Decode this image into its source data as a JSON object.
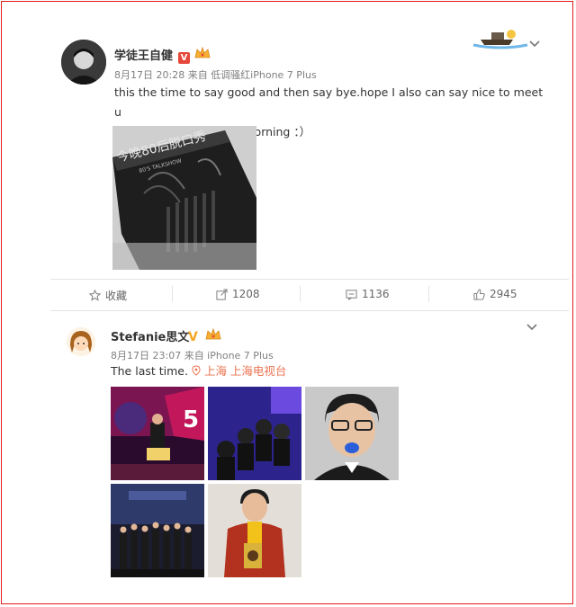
{
  "post1": {
    "author": "学徒王自健",
    "meta": "8月17日 20:28 来自 低调骚红iPhone 7 Plus",
    "text_line1": "this the time to say good and then say bye.hope I also can say nice to meet u",
    "text_line2": "tomorrow in tomorrow morning ：）",
    "image_caption": "今晚80后脱口秀",
    "image_sub": "80'S TALKSHOW",
    "actions": {
      "favorite": "收藏",
      "repost": "1208",
      "comment": "1136",
      "like": "2945"
    }
  },
  "post2": {
    "author": "Stefanie思文",
    "meta": "8月17日 23:07 来自 iPhone 7 Plus",
    "text": "The last time.",
    "location": "上海 上海电视台",
    "photo_overlay_number": "5"
  },
  "colors": {
    "accent_orange": "#eb7350",
    "verified_red": "#e6473a",
    "frame_red": "#e31b1b"
  }
}
